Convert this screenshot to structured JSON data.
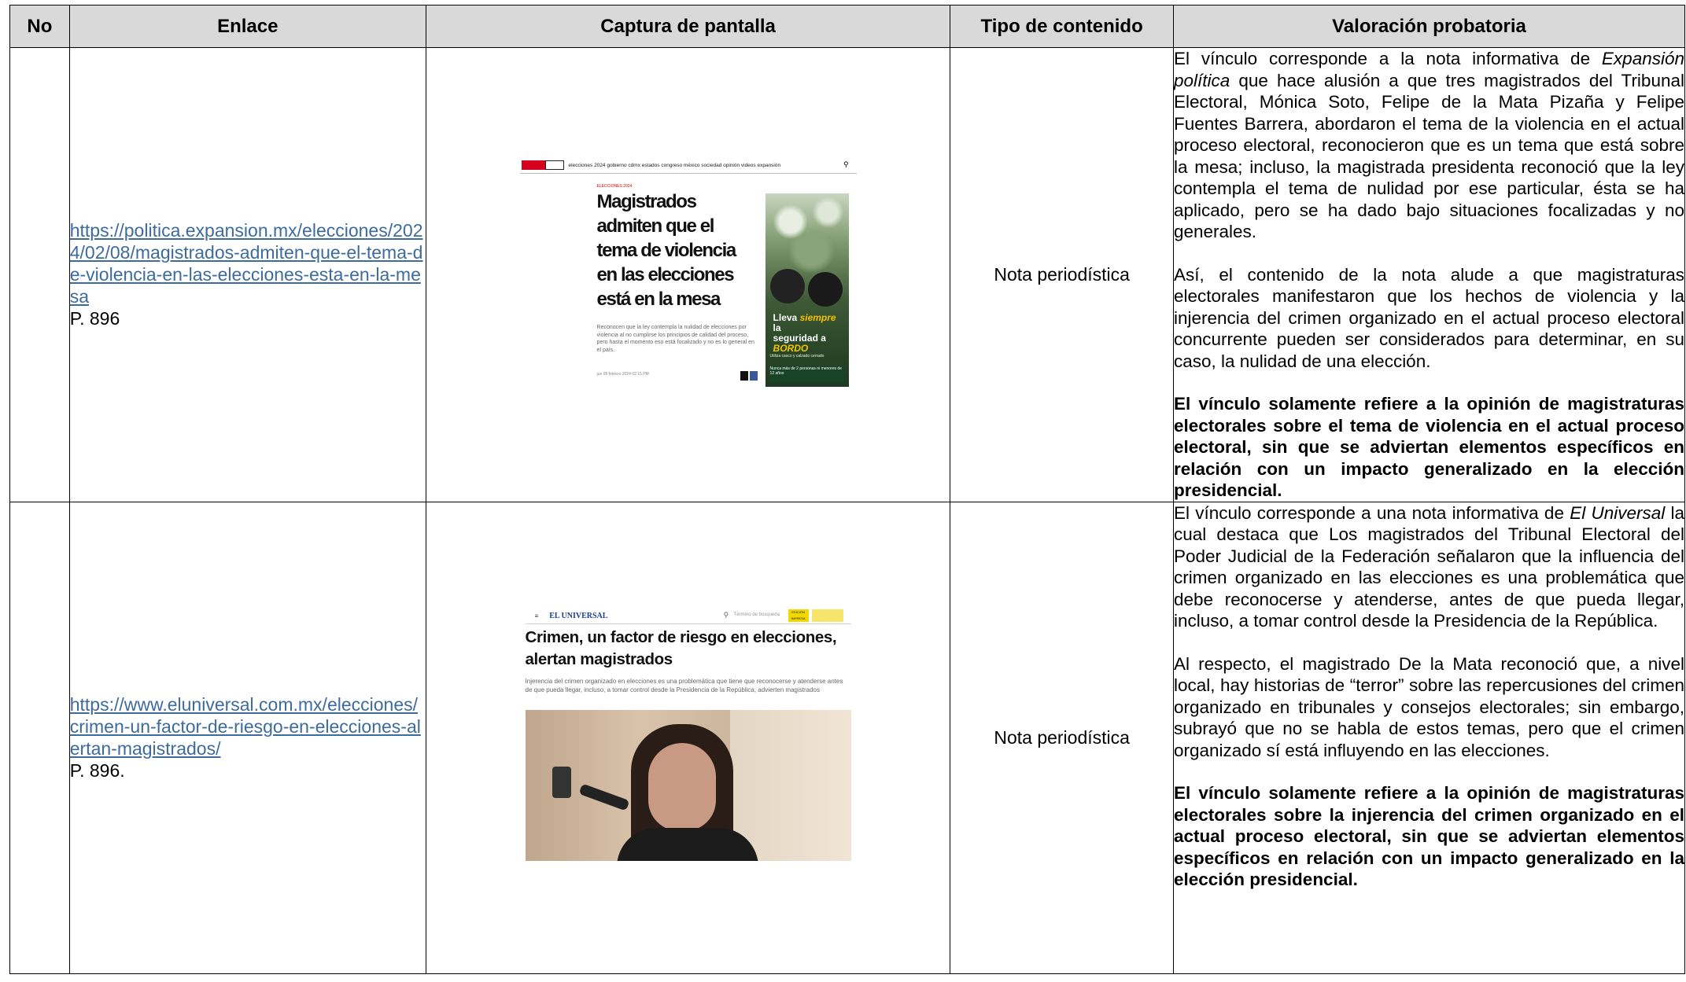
{
  "table": {
    "headers": {
      "no": "No",
      "enlace": "Enlace",
      "captura": "Captura de pantalla",
      "tipo": "Tipo de contenido",
      "valoracion": "Valoración probatoria"
    },
    "rows": [
      {
        "no": "",
        "link_text": "https://politica.expansion.mx/elecciones/2024/02/08/magistrados-admiten-que-el-tema-de-violencia-en-las-elecciones-esta-en-la-mesa",
        "page": "P. 896",
        "tipo": "Nota periodística",
        "val_p1_pre": "El vínculo corresponde a la nota informativa de ",
        "val_p1_em": "Expansión política",
        "val_p1_post": " que hace alusión a que tres magistrados del Tribunal Electoral, Mónica Soto, Felipe de la Mata Pizaña y Felipe Fuentes Barrera, abordaron el tema de la violencia en el actual proceso electoral, reconocieron que es un tema que está sobre la mesa; incluso, la magistrada presidenta reconoció que la ley contempla el tema de nulidad por ese particular, ésta se ha aplicado, pero se ha dado bajo situaciones focalizadas y no generales.",
        "val_p2": "Así, el contenido de la nota alude a que magistraturas electorales manifestaron que los hechos de violencia y la injerencia del crimen organizado en el actual proceso electoral concurrente pueden ser considerados para determinar, en su caso, la nulidad de una elección.",
        "val_p3": "El vínculo solamente refiere a la opinión de magistraturas electorales sobre el tema de violencia en el actual proceso electoral, sin que se adviertan elementos específicos en relación con un impacto generalizado en la elección presidencial.",
        "screenshot": {
          "nav_items": "elecciones 2024   gobierno   cdmx   estados   congreso   méxico   sociedad   opinión   videos   expansión",
          "kicker": "ELECCIONES 2024",
          "headline": "Magistrados admiten que el tema de violencia en las elecciones está en la mesa",
          "summary": "Reconocen que la ley contempla la nulidad de elecciones por violencia al no cumplirse los principios de calidad del proceso, pero hasta el momento eso está focalizado y no es lo general en el país.",
          "meta": "jue 08 febrero 2024 02:15 PM",
          "ad_line1": "Lleva ",
          "ad_line1_em": "siempre",
          "ad_line1_post": " la",
          "ad_line2": "seguridad a",
          "ad_line3": "BORDO",
          "ad_fine": "Utiliza casco y calzado cerrado",
          "ad_box": "Nunca más de 2 personas ni menores de 12 años",
          "colors": {
            "brand_red": "#d5001c",
            "ad_green": "#2d4a2a",
            "ad_yellow": "#f4c300"
          }
        }
      },
      {
        "no": "",
        "link_text": "https://www.eluniversal.com.mx/elecciones/crimen-un-factor-de-riesgo-en-elecciones-alertan-magistrados/",
        "page": "P. 896.",
        "tipo": "Nota periodística",
        "val_p1_pre": "El vínculo corresponde a una nota informativa de ",
        "val_p1_em": "El Universal",
        "val_p1_post": " la cual destaca que Los magistrados del Tribunal Electoral del Poder Judicial de la Federación señalaron que la influencia del crimen organizado en las elecciones es una problemática que debe reconocerse y atenderse, antes de que pueda llegar, incluso, a tomar control desde la Presidencia de la República.",
        "val_p2": "Al respecto, el magistrado De la Mata reconoció que, a nivel local, hay historias de “terror” sobre las repercusiones del crimen organizado en tribunales y consejos electorales; sin embargo, subrayó que no se habla de estos temas, pero que el crimen organizado sí está influyendo en las elecciones.",
        "val_p3": "El vínculo solamente refiere a la opinión de magistraturas electorales sobre la injerencia del crimen organizado en el actual proceso electoral, sin que se adviertan elementos específicos en relación con un impacto generalizado en la elección presidencial.",
        "screenshot": {
          "menu": "≡",
          "brand": "EL UNIVERSAL",
          "search_placeholder": "Término de búsqueda",
          "badge1": "EDICIÓN IMPRESA",
          "badge2": "",
          "headline": "Crimen, un factor de riesgo en elecciones, alertan magistrados",
          "summary": "Injerencia del crimen organizado en elecciones es una problemática que tiene que reconocerse y atenderse antes de que pueda llegar, incluso, a tomar control desde la Presidencia de la República, advierten magistrados",
          "colors": {
            "brand_blue": "#1c3f8f",
            "badge_yellow": "#f2d700"
          }
        }
      }
    ]
  },
  "colors": {
    "header_bg": "#d9d9d9",
    "link": "#3d6b9e"
  }
}
